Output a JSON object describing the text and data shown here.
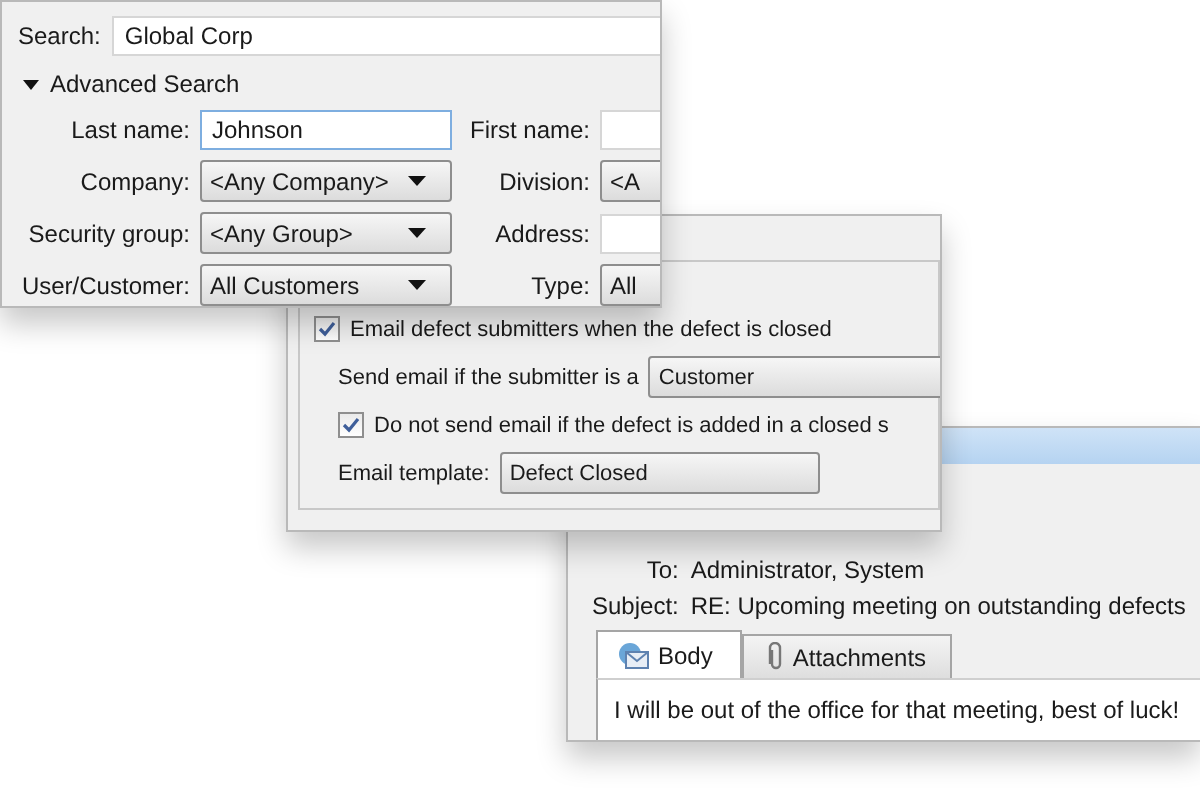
{
  "search_window": {
    "search": {
      "label": "Search:",
      "value": "Global Corp"
    },
    "advanced": {
      "label": "Advanced Search",
      "expanded": true
    },
    "fields": [
      {
        "kind": "text",
        "label": "Last name:",
        "value": "Johnson",
        "focused": true
      },
      {
        "kind": "text",
        "label": "First name:",
        "focused": false
      },
      {
        "kind": "dropdown",
        "label": "Company:",
        "value": "<Any Company>"
      },
      {
        "kind": "dropdown",
        "label": "Division:",
        "value": "<A"
      },
      {
        "kind": "dropdown",
        "label": "Security group:",
        "value": "<Any Group>"
      },
      {
        "kind": "text",
        "label": "Address:",
        "focused": false
      },
      {
        "kind": "dropdown",
        "label": "User/Customer:",
        "value": "All Customers"
      },
      {
        "kind": "dropdown",
        "label": "Type:",
        "value": "All"
      }
    ]
  },
  "notify_window": {
    "notify": {
      "label": "Email defect submitters when the defect is closed",
      "checked": true
    },
    "submitter": {
      "label": "Send email if the submitter is a",
      "value": "Customer"
    },
    "closed_state": {
      "label": "Do not send email if the defect is added in a closed s",
      "checked": true
    },
    "template": {
      "label": "Email template:",
      "value": "Defect Closed"
    }
  },
  "email_window": {
    "to": {
      "label": "To:",
      "value": "Administrator, System"
    },
    "subject": {
      "label": "Subject:",
      "value": "RE: Upcoming meeting on outstanding defects"
    },
    "tabs": [
      {
        "label": "Body",
        "kind": "envelope",
        "selected": true
      },
      {
        "label": "Attachments",
        "kind": "paperclip",
        "selected": false
      }
    ],
    "body": "I will be out of the office for that meeting, best of luck!"
  }
}
